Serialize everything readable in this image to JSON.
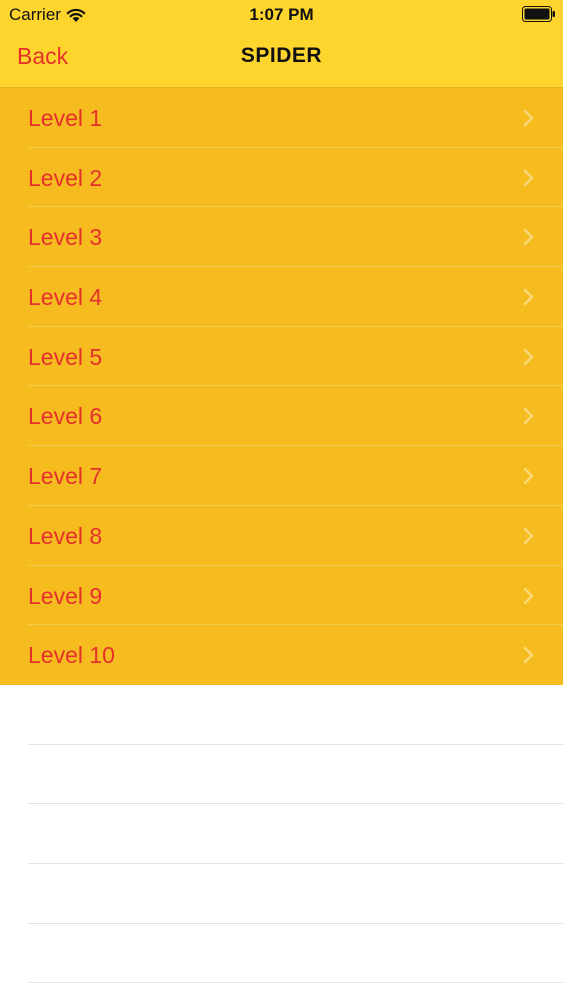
{
  "status_bar": {
    "carrier": "Carrier",
    "time": "1:07 PM",
    "wifi_icon": "wifi-icon",
    "battery_icon": "battery-full-icon"
  },
  "nav": {
    "back_label": "Back",
    "title": "SPIDER"
  },
  "levels": [
    {
      "label": "Level 1"
    },
    {
      "label": "Level 2"
    },
    {
      "label": "Level 3"
    },
    {
      "label": "Level 4"
    },
    {
      "label": "Level 5"
    },
    {
      "label": "Level 6"
    },
    {
      "label": "Level 7"
    },
    {
      "label": "Level 8"
    },
    {
      "label": "Level 9"
    },
    {
      "label": "Level 10"
    }
  ],
  "colors": {
    "header_background": "#fdd52c",
    "list_background": "#f6bc1f",
    "accent_text": "#e5302c",
    "chevron": "#f8d978"
  }
}
